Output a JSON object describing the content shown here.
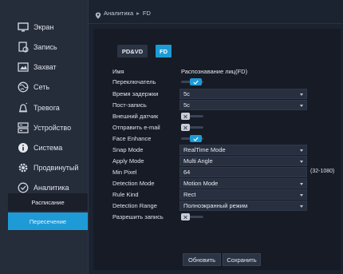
{
  "sidebar": {
    "items": [
      {
        "label": "Экран",
        "icon": "monitor-icon"
      },
      {
        "label": "Запись",
        "icon": "record-icon"
      },
      {
        "label": "Захват",
        "icon": "capture-icon"
      },
      {
        "label": "Сеть",
        "icon": "globe-icon"
      },
      {
        "label": "Тревога",
        "icon": "alarm-icon"
      },
      {
        "label": "Устройство",
        "icon": "device-icon"
      },
      {
        "label": "Система",
        "icon": "info-icon"
      },
      {
        "label": "Продвинутый",
        "icon": "gear-icon"
      },
      {
        "label": "Аналитика",
        "icon": "analytics-icon"
      }
    ],
    "sub_items": {
      "schedule": "Расписание",
      "intersect": "Пересечение"
    }
  },
  "breadcrumb": {
    "section": "Аналитика",
    "page": "FD"
  },
  "tabs": {
    "pdvd": "PD&VD",
    "fd": "FD"
  },
  "form": {
    "name": {
      "label": "Имя",
      "value": "Распознавание лиц(FD)"
    },
    "switch": {
      "label": "Переключатель",
      "on": true
    },
    "delay": {
      "label": "Время задержки",
      "value": "5с"
    },
    "post_record": {
      "label": "Пост-запись",
      "value": "5с"
    },
    "external_sensor": {
      "label": "Внешний датчик",
      "on": false
    },
    "send_email": {
      "label": "Отправить e-mail",
      "on": false
    },
    "face_enhance": {
      "label": "Face Enhance",
      "on": true
    },
    "snap_mode": {
      "label": "Snap Mode",
      "value": "RealTime Mode"
    },
    "apply_mode": {
      "label": "Apply Mode",
      "value": "Multi Angle"
    },
    "min_pixel": {
      "label": "Min Pixel",
      "value": "64",
      "range": "(32-1080)"
    },
    "detection_mode": {
      "label": "Detection Mode",
      "value": "Motion Mode"
    },
    "rule_kind": {
      "label": "Rule Kind",
      "value": "Rect"
    },
    "detection_range": {
      "label": "Detection Range",
      "value": "Полноэкранный режим"
    },
    "allow_record": {
      "label": "Разрешить запись",
      "on": false
    }
  },
  "buttons": {
    "refresh": "Обновить",
    "save": "Сохранить"
  },
  "colors": {
    "accent": "#1e9bd7",
    "background": "#1b2230",
    "sidebar": "#252c3a"
  }
}
